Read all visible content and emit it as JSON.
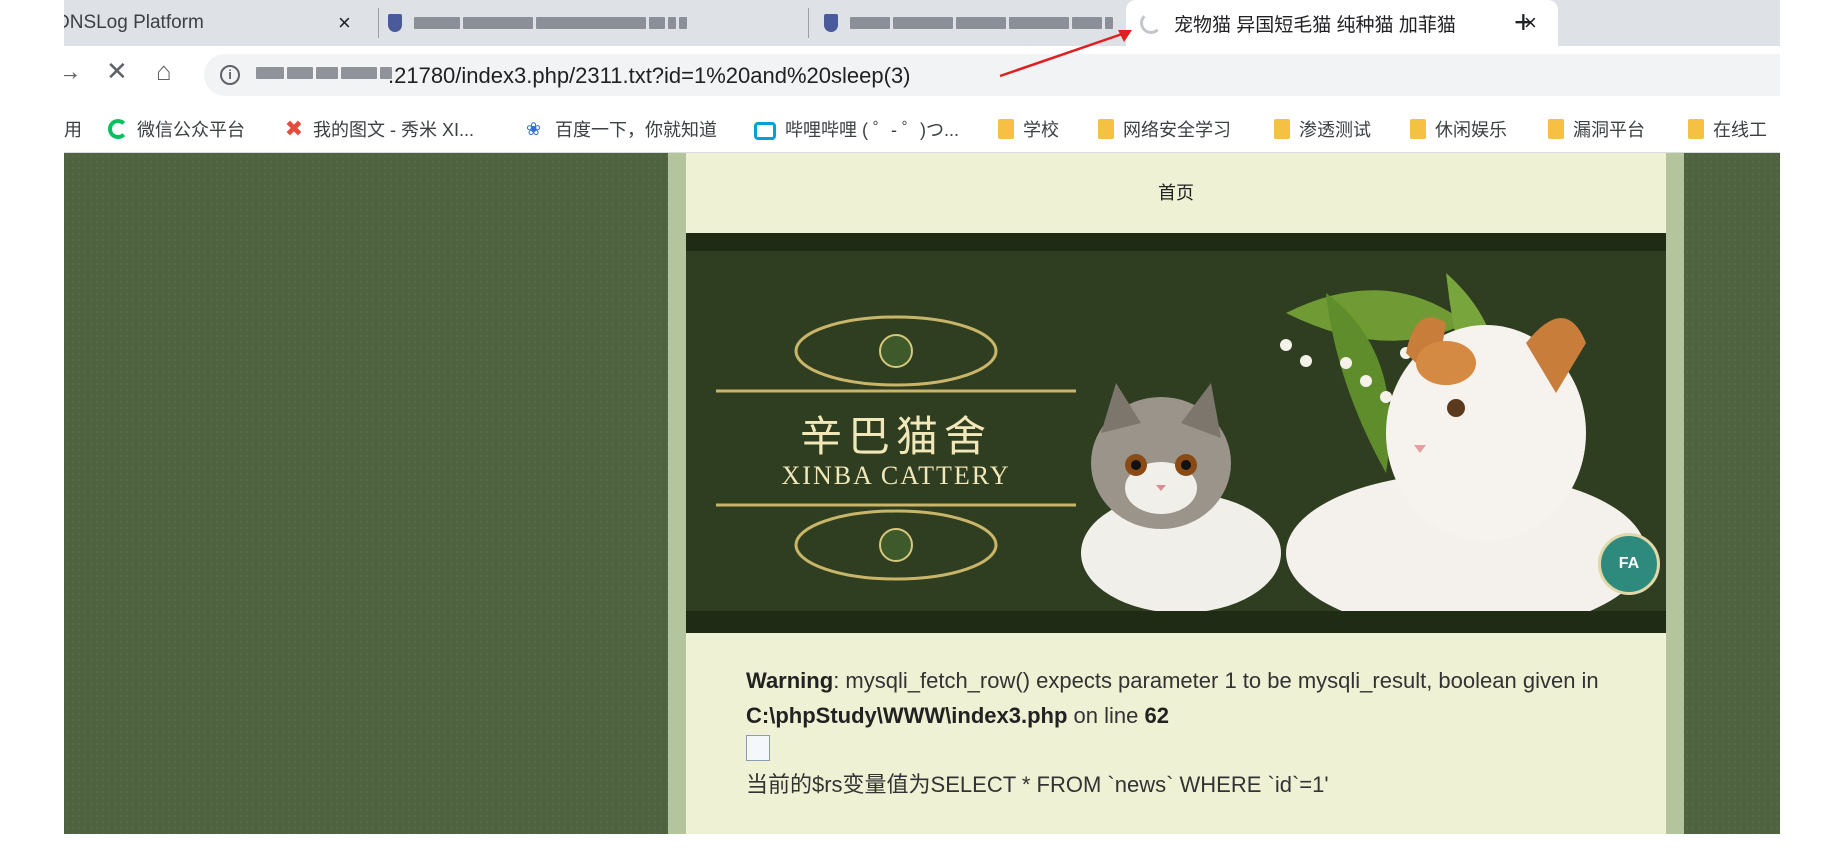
{
  "tabs": [
    {
      "title": "DNSLog Platform",
      "close": "×"
    },
    {
      "title": "",
      "blurred": true
    },
    {
      "title": "",
      "blurred": true
    },
    {
      "title": "宠物猫 异国短毛猫 纯种猫 加菲猫",
      "close": "×",
      "loading": true
    }
  ],
  "new_tab_label": "+",
  "toolbar": {
    "back": "←",
    "forward": "→",
    "stop": "✕",
    "home": "⌂",
    "url": ".21780/index3.php/2311.txt?id=1%20and%20sleep(3)"
  },
  "bookmarks": [
    {
      "label": "用",
      "icon": "apps-icon"
    },
    {
      "label": "微信公众平台",
      "icon": "wechat-mp-icon",
      "color": "#07c160"
    },
    {
      "label": "我的图文 - 秀米 XI...",
      "icon": "xiumi-icon"
    },
    {
      "label": "百度一下，你就知道",
      "icon": "baidu-paw-icon",
      "color": "#2f6fe0"
    },
    {
      "label": "哔哩哔哩 ( ゜- ゜)つ...",
      "icon": "bilibili-icon",
      "color": "#00a1d6"
    },
    {
      "label": "学校",
      "icon": "folder-icon"
    },
    {
      "label": "网络安全学习",
      "icon": "folder-icon"
    },
    {
      "label": "渗透测试",
      "icon": "folder-icon"
    },
    {
      "label": "休闲娱乐",
      "icon": "folder-icon"
    },
    {
      "label": "漏洞平台",
      "icon": "folder-icon"
    },
    {
      "label": "在线工",
      "icon": "folder-icon"
    }
  ],
  "page": {
    "nav_home": "首页",
    "banner": {
      "logo_cn": "辛巴猫舍",
      "logo_en": "XINBA CATTERY",
      "badge": "FA"
    },
    "warning": {
      "label": "Warning",
      "message": ": mysqli_fetch_row() expects parameter 1 to be mysqli_result, boolean given in ",
      "path": "C:\\phpStudy\\WWW\\index3.php",
      "on_line": " on line ",
      "line": "62"
    },
    "rs_text": "当前的$rs变量值为SELECT * FROM `news` WHERE `id`=1'"
  },
  "colors": {
    "page_bg": "#4f6341",
    "annotation": "#e02020"
  }
}
